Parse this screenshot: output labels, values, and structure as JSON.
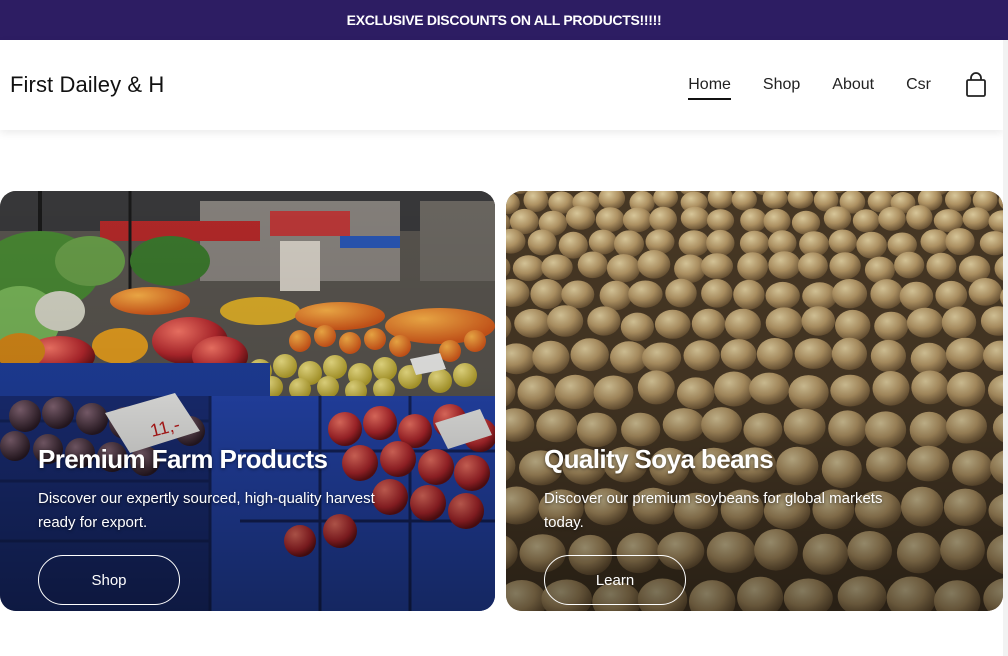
{
  "announcement": {
    "text": "EXCLUSIVE DISCOUNTS ON ALL PRODUCTS!!!!!"
  },
  "header": {
    "brand": "First Dailey & H",
    "nav": [
      {
        "label": "Home",
        "active": true
      },
      {
        "label": "Shop",
        "active": false
      },
      {
        "label": "About",
        "active": false
      },
      {
        "label": "Csr",
        "active": false
      }
    ],
    "cart_icon": "shopping-bag-icon"
  },
  "cards": [
    {
      "title": "Premium Farm Products",
      "text": "Discover our expertly sourced, high-quality harvest ready for export.",
      "button": "Shop",
      "image": "market-produce-image"
    },
    {
      "title": "Quality Soya beans",
      "text": "Discover our premium soybeans for global markets today.",
      "button": "Learn",
      "image": "soybeans-image"
    }
  ],
  "colors": {
    "announcement_bg": "#2d1d63",
    "text_dark": "#111111",
    "soy": "#b89a68",
    "produce_red": "#c2161c",
    "crate_blue": "#1f3f9e"
  }
}
